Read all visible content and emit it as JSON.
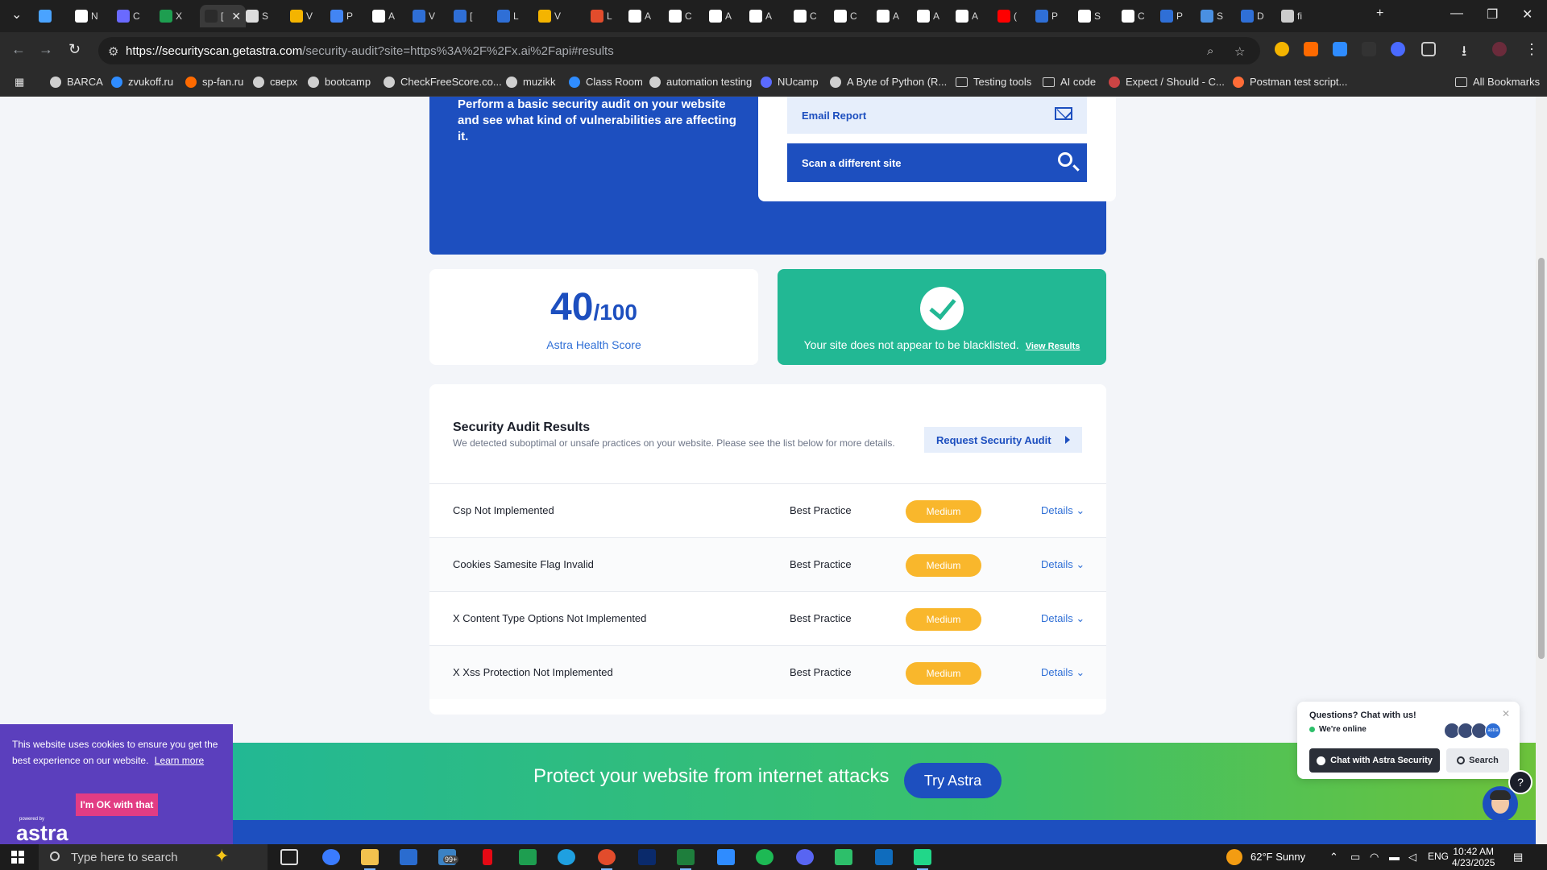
{
  "browser": {
    "tabs": [
      {
        "label": "",
        "color": "#4aa3ff"
      },
      {
        "label": "N",
        "color": "#ffffff"
      },
      {
        "label": "C",
        "color": "#6a6aff"
      },
      {
        "label": "X",
        "color": "#1e9e50"
      },
      {
        "label": "[",
        "color": "#2b2b2b"
      },
      {
        "label": "S",
        "color": "#dddddd"
      },
      {
        "label": "V",
        "color": "#f4b400"
      },
      {
        "label": "P",
        "color": "#4285f4"
      },
      {
        "label": "A",
        "color": "#ffffff"
      },
      {
        "label": "V",
        "color": "#2f6fd6"
      },
      {
        "label": "[",
        "color": "#2f6fd6"
      },
      {
        "label": "L",
        "color": "#2f6fd6"
      },
      {
        "label": "V",
        "color": "#f4b400"
      },
      {
        "label": "L",
        "color": "#e24c2c"
      },
      {
        "label": "A",
        "color": "#ffffff"
      },
      {
        "label": "C",
        "color": "#ffffff"
      },
      {
        "label": "A",
        "color": "#ffffff"
      },
      {
        "label": "A",
        "color": "#ffffff"
      },
      {
        "label": "C",
        "color": "#ffffff"
      },
      {
        "label": "C",
        "color": "#ffffff"
      },
      {
        "label": "A",
        "color": "#ffffff"
      },
      {
        "label": "A",
        "color": "#ffffff"
      },
      {
        "label": "A",
        "color": "#ffffff"
      },
      {
        "label": "(",
        "color": "#ff0000"
      },
      {
        "label": "P",
        "color": "#2f6fd6"
      },
      {
        "label": "S",
        "color": "#ffffff"
      },
      {
        "label": "C",
        "color": "#ffffff"
      },
      {
        "label": "P",
        "color": "#2f6fd6"
      },
      {
        "label": "S",
        "color": "#4a90e2"
      },
      {
        "label": "D",
        "color": "#2f6fd6"
      },
      {
        "label": "fi",
        "color": "#cccccc"
      }
    ],
    "url_host": "https://securityscan.getastra.com",
    "url_path": "/security-audit?site=https%3A%2F%2Fx.ai%2Fapi#results",
    "bookmarks": [
      {
        "label": "BARCA",
        "color": "#cfcfcf"
      },
      {
        "label": "zvukoff.ru",
        "color": "#2f8cff"
      },
      {
        "label": "sp-fan.ru",
        "color": "#ff6a00"
      },
      {
        "label": "сверх",
        "color": "#cfcfcf"
      },
      {
        "label": "bootcamp",
        "color": "#cfcfcf"
      },
      {
        "label": "CheckFreeScore.co...",
        "color": "#cfcfcf"
      },
      {
        "label": "muzikk",
        "color": "#cfcfcf"
      },
      {
        "label": "Class Room",
        "color": "#2f8cff"
      },
      {
        "label": "automation testing",
        "color": "#cfcfcf"
      },
      {
        "label": "NUcamp",
        "color": "#5a6aff"
      },
      {
        "label": "A Byte of Python (R...",
        "color": "#cfcfcf"
      },
      {
        "label": "Testing tools",
        "color": "folder"
      },
      {
        "label": "AI code",
        "color": "folder"
      },
      {
        "label": "Expect / Should - C...",
        "color": "#c44"
      },
      {
        "label": "Postman test script...",
        "color": "#ff6c37"
      }
    ],
    "all_bookmarks": "All Bookmarks"
  },
  "hero": {
    "description": "Perform a basic security audit on your website and see what kind of vulnerabilities are affecting it.",
    "email_report": "Email Report",
    "scan_different": "Scan a different site"
  },
  "score": {
    "value": "40",
    "denominator": "/100",
    "label": "Astra Health Score"
  },
  "blacklist": {
    "text": "Your site does not appear to be blacklisted.",
    "link": "View Results"
  },
  "results": {
    "title": "Security Audit Results",
    "subtitle": "We detected suboptimal or unsafe practices on your website. Please see the list below for more details.",
    "request_button": "Request Security Audit",
    "rows": [
      {
        "name": "Csp Not Implemented",
        "category": "Best Practice",
        "severity": "Medium",
        "details": "Details"
      },
      {
        "name": "Cookies Samesite Flag Invalid",
        "category": "Best Practice",
        "severity": "Medium",
        "details": "Details"
      },
      {
        "name": "X Content Type Options Not Implemented",
        "category": "Best Practice",
        "severity": "Medium",
        "details": "Details"
      },
      {
        "name": "X Xss Protection Not Implemented",
        "category": "Best Practice",
        "severity": "Medium",
        "details": "Details"
      }
    ]
  },
  "cta": {
    "text": "Protect your website from internet attacks",
    "button": "Try Astra"
  },
  "cookie": {
    "text": "This website uses cookies to ensure you get the best experience on our website.",
    "learn_more": "Learn more",
    "button": "I'm OK with that",
    "logo_powered": "powered by",
    "logo": "astra"
  },
  "chat": {
    "question": "Questions? Chat with us!",
    "online": "We're online",
    "chat_button": "Chat with Astra Security",
    "search_button": "Search",
    "avatar_last": "astra"
  },
  "taskbar": {
    "search_placeholder": "Type here to search",
    "weather": "62°F  Sunny",
    "lang": "ENG",
    "time": "10:42 AM",
    "date": "4/23/2025",
    "badge": "99+"
  },
  "colors": {
    "brand_blue": "#1d4fbf",
    "success_green": "#22b894",
    "medium_orange": "#f9b72c",
    "cookie_purple": "#5b3fbd",
    "cookie_pink": "#e23c84"
  }
}
